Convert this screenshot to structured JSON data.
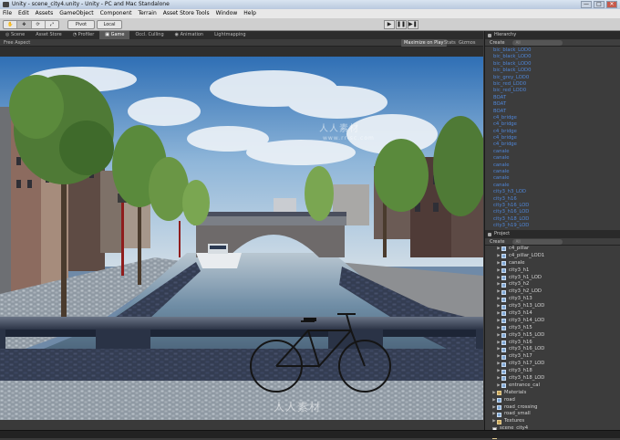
{
  "window": {
    "title": "Unity - scene_city4.unity - Unity - PC and Mac Standalone",
    "min": "—",
    "max": "□",
    "close": "✕"
  },
  "menu": [
    "File",
    "Edit",
    "Assets",
    "GameObject",
    "Component",
    "Terrain",
    "Asset Store Tools",
    "Window",
    "Help"
  ],
  "toolbar": {
    "pivot": "Pivot",
    "local": "Local",
    "play": "▶",
    "pause": "❚❚",
    "step": "▶❚"
  },
  "tabs": [
    "Scene",
    "Asset Store",
    "Profiler",
    "Game",
    "Occl. Culling",
    "Animation",
    "Lightmapping"
  ],
  "gamebar": {
    "aspect": "Free Aspect",
    "maximize": "Maximize on Play",
    "stats": "Stats",
    "gizmos": "Gizmos"
  },
  "hierarchy": {
    "title": "Hierarchy",
    "create": "Create",
    "search": "All",
    "items": [
      "bic_black_LOD0",
      "bic_black_LOD0",
      "bic_black_LOD0",
      "bic_black_LOD0",
      "bic_grey_LOD0",
      "bic_red_LOD0",
      "bic_red_LOD0",
      "BOAT",
      "BOAT",
      "BOAT",
      "c4_bridge",
      "c4_bridge",
      "c4_bridge",
      "c4_bridge",
      "c4_bridge",
      "canale",
      "canale",
      "canale",
      "canale",
      "canale",
      "canale",
      "city3_h3_LOD",
      "city3_h16",
      "city3_h16_LOD",
      "city3_h16_LOD",
      "city3_h18_LOD",
      "city3_h19_LOD"
    ]
  },
  "project": {
    "title": "Project",
    "create": "Create",
    "search": "All",
    "items": [
      {
        "label": "c4_pillar",
        "type": "prefab",
        "indent": 2
      },
      {
        "label": "c4_pillar_LOD1",
        "type": "prefab",
        "indent": 2
      },
      {
        "label": "canale",
        "type": "prefab",
        "indent": 2
      },
      {
        "label": "city3_h1",
        "type": "prefab",
        "indent": 2
      },
      {
        "label": "city3_h1_LOD",
        "type": "prefab",
        "indent": 2
      },
      {
        "label": "city3_h2",
        "type": "prefab",
        "indent": 2
      },
      {
        "label": "city3_h2_LOD",
        "type": "prefab",
        "indent": 2
      },
      {
        "label": "city3_h13",
        "type": "prefab",
        "indent": 2
      },
      {
        "label": "city3_h13_LOD",
        "type": "prefab",
        "indent": 2
      },
      {
        "label": "city3_h14",
        "type": "prefab",
        "indent": 2
      },
      {
        "label": "city3_h14_LOD",
        "type": "prefab",
        "indent": 2
      },
      {
        "label": "city3_h15",
        "type": "prefab",
        "indent": 2
      },
      {
        "label": "city3_h15_LOD",
        "type": "prefab",
        "indent": 2
      },
      {
        "label": "city3_h16",
        "type": "prefab",
        "indent": 2
      },
      {
        "label": "city3_h16_LOD",
        "type": "prefab",
        "indent": 2
      },
      {
        "label": "city3_h17",
        "type": "prefab",
        "indent": 2
      },
      {
        "label": "city3_h17_LOD",
        "type": "prefab",
        "indent": 2
      },
      {
        "label": "city3_h18",
        "type": "prefab",
        "indent": 2
      },
      {
        "label": "city3_h18_LOD",
        "type": "prefab",
        "indent": 2
      },
      {
        "label": "entrance_cal",
        "type": "prefab",
        "indent": 2
      },
      {
        "label": "Materials",
        "type": "folder",
        "indent": 1
      },
      {
        "label": "road",
        "type": "prefab",
        "indent": 1
      },
      {
        "label": "road_crossing",
        "type": "prefab",
        "indent": 1
      },
      {
        "label": "road_small",
        "type": "prefab",
        "indent": 1
      },
      {
        "label": "Textures",
        "type": "folder",
        "indent": 1
      },
      {
        "label": "scene_city4",
        "type": "scene",
        "indent": 0
      },
      {
        "label": "Standard Assets",
        "type": "folder",
        "indent": 0
      }
    ]
  },
  "watermarks": {
    "brand_cn": "人人素材",
    "site": "www.rr-sc.com"
  }
}
